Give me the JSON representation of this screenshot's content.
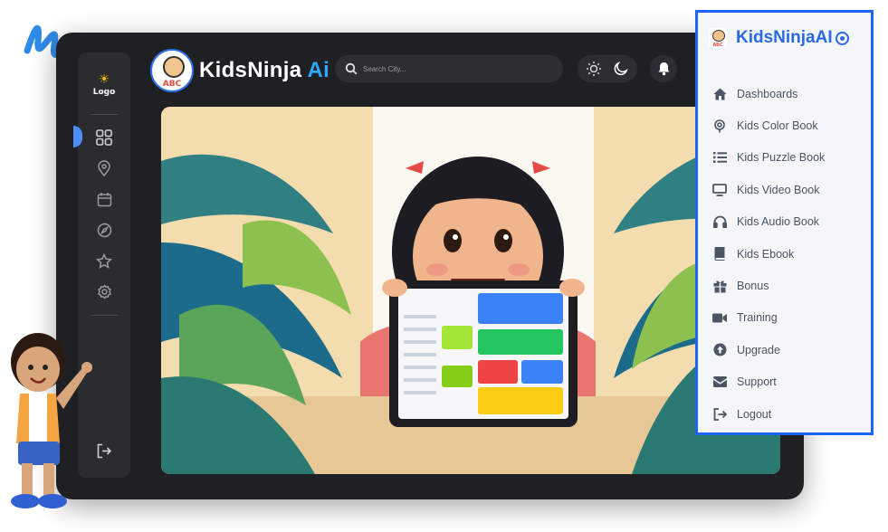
{
  "brand": {
    "name_main": "KidsNinja",
    "name_ai": "Ai",
    "badge_text": "ABC"
  },
  "rail": {
    "logo_label": "Logo",
    "icons": [
      "grid-icon",
      "location-pin-icon",
      "calendar-icon",
      "compass-icon",
      "star-icon",
      "settings-icon"
    ],
    "bottom_icon": "logout-icon"
  },
  "search": {
    "placeholder": "Search City..."
  },
  "topbar": {
    "theme_light_icon": "sun-icon",
    "theme_dark_icon": "moon-icon",
    "notification_icon": "bell-icon"
  },
  "sidebar_panel": {
    "title": "KidsNinjaAI",
    "items": [
      {
        "label": "Dashboards",
        "icon": "home-icon"
      },
      {
        "label": "Kids Color Book",
        "icon": "color-book-icon"
      },
      {
        "label": "Kids Puzzle Book",
        "icon": "list-icon"
      },
      {
        "label": "Kids Video Book",
        "icon": "monitor-icon"
      },
      {
        "label": "Kids Audio Book",
        "icon": "headphones-icon"
      },
      {
        "label": "Kids Ebook",
        "icon": "book-icon"
      },
      {
        "label": "Bonus",
        "icon": "gift-icon"
      },
      {
        "label": "Training",
        "icon": "video-camera-icon"
      },
      {
        "label": "Upgrade",
        "icon": "arrow-up-circle-icon"
      },
      {
        "label": "Support",
        "icon": "envelope-icon"
      },
      {
        "label": "Logout",
        "icon": "logout-icon"
      }
    ]
  },
  "colors": {
    "app_bg": "#1f2023",
    "accent": "#1c64ff",
    "brand_blue": "#2a6ae8",
    "ai_cyan": "#2aa9ff"
  }
}
